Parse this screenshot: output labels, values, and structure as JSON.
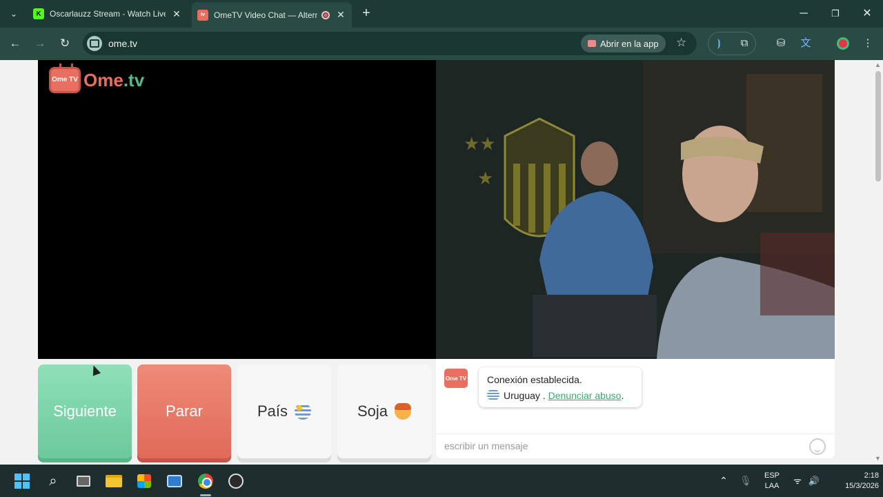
{
  "browser": {
    "tabs": [
      {
        "title": "Oscarlauzz Stream - Watch Live",
        "active": false
      },
      {
        "title": "OmeTV Video Chat — Altern",
        "active": true
      }
    ],
    "url": "ome.tv",
    "open_app_label": "Abrir en la app"
  },
  "site": {
    "logo_badge": "Ome TV",
    "logo_name": "Ome",
    "logo_suffix": ".tv"
  },
  "controls": {
    "next_label": "Siguiente",
    "stop_label": "Parar",
    "country_label": "País",
    "gender_label": "Soja"
  },
  "chat": {
    "avatar_text": "Ome TV",
    "status_message": "Conexión establecida.",
    "country": "Uruguay",
    "separator": " . ",
    "report_link": "Denunciar abuso",
    "report_suffix": ".",
    "input_placeholder": "escribir un mensaje"
  },
  "taskbar": {
    "language_line1": "ESP",
    "language_line2": "LAA",
    "time": "2:18",
    "date": "15/3/2026"
  },
  "colors": {
    "next_button": "#7dd6aa",
    "stop_button": "#e8776a",
    "brand_red": "#e86f5f",
    "brand_green": "#57b98a"
  }
}
